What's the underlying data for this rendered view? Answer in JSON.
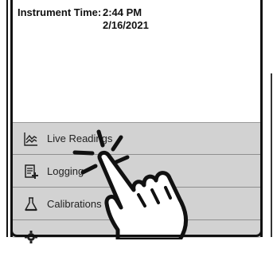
{
  "instrument": {
    "label": "Instrument Time:",
    "time": "2:44 PM",
    "date": "2/16/2021"
  },
  "menu": {
    "items": [
      {
        "label": "Live Readings",
        "icon": "chart-line-icon"
      },
      {
        "label": "Logging",
        "icon": "log-list-icon"
      },
      {
        "label": "Calibrations",
        "icon": "flask-icon"
      },
      {
        "label": "",
        "icon": "gear-icon"
      }
    ]
  },
  "overlay": {
    "icon": "tap-hand-icon"
  },
  "colors": {
    "menu_bg": "#d2d2d2",
    "divider": "#8f8f8f",
    "frame": "#111111"
  }
}
